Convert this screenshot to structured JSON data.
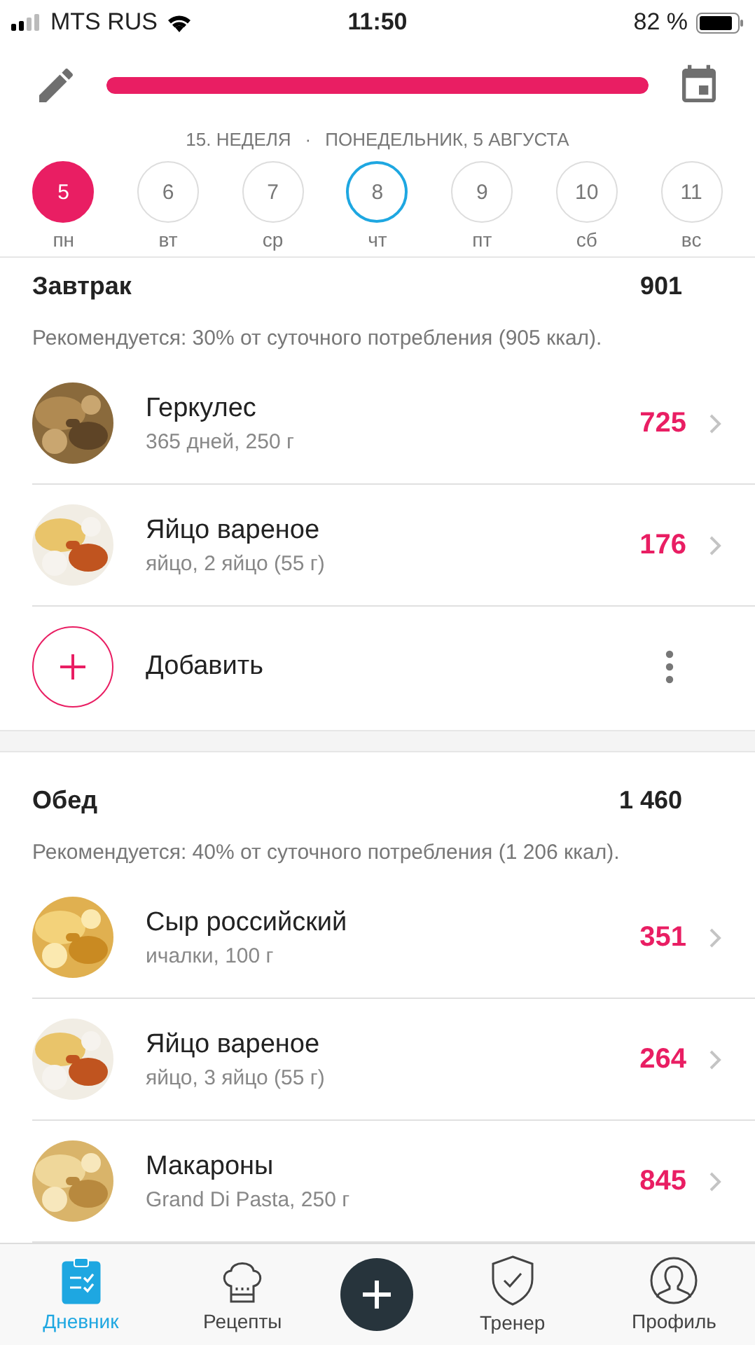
{
  "status_bar": {
    "carrier": "MTS RUS",
    "time": "11:50",
    "battery": "82 %"
  },
  "progress": {
    "level": 1
  },
  "week_label": "15. НЕДЕЛЯ",
  "separator": "·",
  "date_label": "ПОНЕДЕЛЬНИК, 5 АВГУСТА",
  "days": [
    {
      "number": "5",
      "weekday": "пн",
      "selected": true,
      "today": false
    },
    {
      "number": "6",
      "weekday": "вт",
      "selected": false,
      "today": false
    },
    {
      "number": "7",
      "weekday": "ср",
      "selected": false,
      "today": false
    },
    {
      "number": "8",
      "weekday": "чт",
      "selected": false,
      "today": true
    },
    {
      "number": "9",
      "weekday": "пт",
      "selected": false,
      "today": false
    },
    {
      "number": "10",
      "weekday": "сб",
      "selected": false,
      "today": false
    },
    {
      "number": "11",
      "weekday": "вс",
      "selected": false,
      "today": false
    }
  ],
  "meals": [
    {
      "title": "Завтрак",
      "total": "901",
      "recommendation": "Рекомендуется: 30% от суточного потребления (905 ккал).",
      "add_label": "Добавить",
      "items": [
        {
          "name": "Геркулес",
          "detail": "365 дней, 250 г",
          "kcal": "725"
        },
        {
          "name": "Яйцо вареное",
          "detail": "яйцо, 2 яйцо (55 г)",
          "kcal": "176"
        }
      ]
    },
    {
      "title": "Обед",
      "total": "1 460",
      "recommendation": "Рекомендуется: 40% от суточного потребления (1 206 ккал).",
      "items": [
        {
          "name": "Сыр российский",
          "detail": "ичалки, 100 г",
          "kcal": "351"
        },
        {
          "name": "Яйцо вареное",
          "detail": "яйцо, 3 яйцо (55 г)",
          "kcal": "264"
        },
        {
          "name": "Макароны",
          "detail": "Grand Di Pasta, 250 г",
          "kcal": "845"
        }
      ]
    }
  ],
  "tabs": [
    {
      "label": "Дневник",
      "selected": true
    },
    {
      "label": "Рецепты",
      "selected": false
    },
    {
      "label": "Тренер",
      "selected": false
    },
    {
      "label": "Профиль",
      "selected": false
    }
  ]
}
